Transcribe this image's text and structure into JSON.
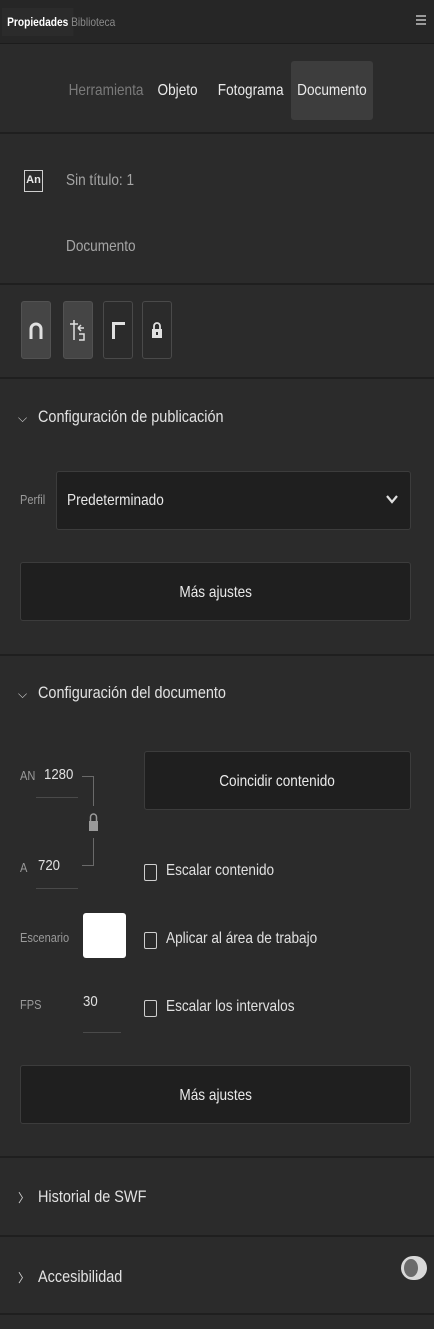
{
  "panel": {
    "tabs": [
      {
        "label": "Propiedades",
        "active": true
      },
      {
        "label": "Biblioteca",
        "active": false
      }
    ],
    "menu_icon": "hamburger-menu-icon"
  },
  "mode_tabs": [
    {
      "label": "Herramienta",
      "enabled": false
    },
    {
      "label": "Objeto",
      "enabled": true
    },
    {
      "label": "Fotograma",
      "enabled": true
    },
    {
      "label": "Documento",
      "enabled": true,
      "active": true
    }
  ],
  "document": {
    "icon_text": "An",
    "title": "Sin título: 1",
    "subtitle": "Documento"
  },
  "toolbar": {
    "icons": [
      "magnet-snap-icon",
      "object-anchor-icon",
      "ruler-icon",
      "lock-icon"
    ]
  },
  "publish": {
    "heading": "Configuración de publicación",
    "profile_label": "Perfil",
    "profile_value": "Predeterminado",
    "more_button": "Más ajustes"
  },
  "doc_settings": {
    "heading": "Configuración del documento",
    "width_label": "AN",
    "width_value": "1280",
    "height_label": "A",
    "height_value": "720",
    "match_button": "Coincidir contenido",
    "scale_content": "Escalar contenido",
    "stage_label": "Escenario",
    "stage_color": "#ffffff",
    "apply_workspace": "Aplicar al área de trabajo",
    "fps_label": "FPS",
    "fps_value": "30",
    "scale_intervals": "Escalar los intervalos",
    "more_button": "Más ajustes"
  },
  "swf_history": {
    "heading": "Historial de SWF"
  },
  "accessibility": {
    "heading": "Accesibilidad",
    "toggle_on": true
  },
  "colors": {
    "background": "#2b2b2b",
    "field": "#1f1f1f",
    "active_tab": "#3d3d3d"
  }
}
